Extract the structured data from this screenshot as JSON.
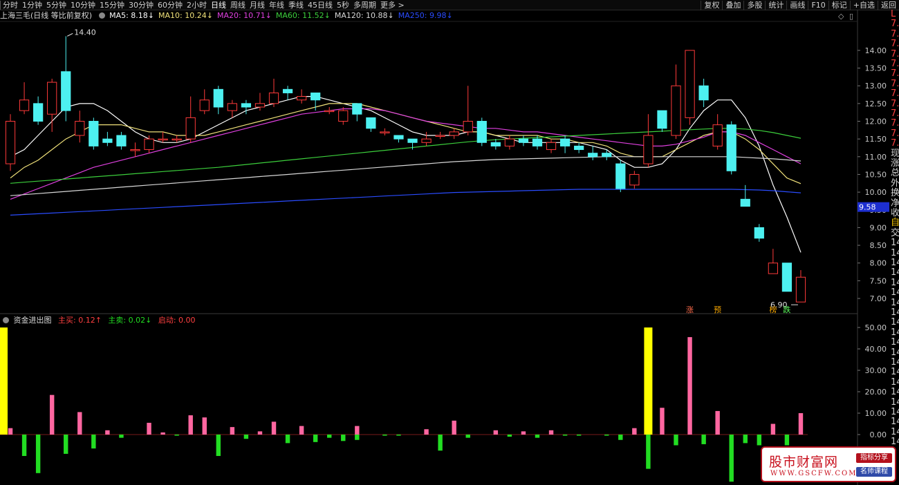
{
  "toolbar": {
    "periods": [
      "分时",
      "1分钟",
      "5分钟",
      "10分钟",
      "15分钟",
      "30分钟",
      "60分钟",
      "2小时",
      "日线",
      "周线",
      "月线",
      "年线",
      "季线",
      "45日线",
      "5秒",
      "多周期",
      "更多 >"
    ],
    "active_period": "日线",
    "right_tools": [
      "复权",
      "叠加",
      "多股",
      "统计",
      "画线",
      "F10",
      "标记",
      "+自选",
      "返回"
    ]
  },
  "legend": {
    "stock": "上海三毛(日线 等比前复权)",
    "ma": [
      {
        "label": "MA5: 8.18↓",
        "color": "#ffffff"
      },
      {
        "label": "MA10: 10.24↓",
        "color": "#f1e27a"
      },
      {
        "label": "MA20: 10.71↓",
        "color": "#e040e0"
      },
      {
        "label": "MA60: 11.52↓",
        "color": "#3cd03c"
      },
      {
        "label": "MA120: 10.88↓",
        "color": "#d8d8d8"
      },
      {
        "label": "MA250: 9.98↓",
        "color": "#2a4cff"
      }
    ]
  },
  "indicator": {
    "title": "资金进出图",
    "buy": "主买: 0.12↑",
    "sell": "主卖: 0.02↓",
    "start": "启动: 0.00"
  },
  "sidebar_chars": [
    {
      "t": "L",
      "c": "#ff4040"
    },
    {
      "t": "7.",
      "c": "#ff4040"
    },
    {
      "t": "7.",
      "c": "#ff4040"
    },
    {
      "t": "7.",
      "c": "#ff4040"
    },
    {
      "t": "7.",
      "c": "#ff4040"
    },
    {
      "t": "7.",
      "c": "#ff4040"
    },
    {
      "t": "7.",
      "c": "#ff4040"
    },
    {
      "t": "7.",
      "c": "#ff4040"
    },
    {
      "t": "7.",
      "c": "#ff4040"
    },
    {
      "t": "7.",
      "c": "#ff4040"
    },
    {
      "t": "7.",
      "c": "#ff4040"
    },
    {
      "t": "7.",
      "c": "#ff4040"
    },
    {
      "t": "7.",
      "c": "#ff4040"
    },
    {
      "t": "7.",
      "c": "#ff4040"
    },
    {
      "t": "现",
      "c": "#d0d0d0"
    },
    {
      "t": "涨",
      "c": "#d0d0d0"
    },
    {
      "t": "总",
      "c": "#d0d0d0"
    },
    {
      "t": "外",
      "c": "#d0d0d0"
    },
    {
      "t": "换",
      "c": "#d0d0d0"
    },
    {
      "t": "净",
      "c": "#d0d0d0"
    },
    {
      "t": "收",
      "c": "#d0d0d0"
    },
    {
      "t": "自",
      "c": "#f0c000"
    },
    {
      "t": "交",
      "c": "#d0d0d0"
    },
    {
      "t": "14",
      "c": "#d0d0d0"
    },
    {
      "t": "14",
      "c": "#d0d0d0"
    },
    {
      "t": "14",
      "c": "#d0d0d0"
    },
    {
      "t": "14",
      "c": "#d0d0d0"
    },
    {
      "t": "14",
      "c": "#d0d0d0"
    },
    {
      "t": "14",
      "c": "#d0d0d0"
    },
    {
      "t": "14",
      "c": "#d0d0d0"
    },
    {
      "t": "14",
      "c": "#d0d0d0"
    },
    {
      "t": "14",
      "c": "#d0d0d0"
    },
    {
      "t": "14",
      "c": "#d0d0d0"
    },
    {
      "t": "14",
      "c": "#d0d0d0"
    },
    {
      "t": "14",
      "c": "#d0d0d0"
    },
    {
      "t": "14",
      "c": "#d0d0d0"
    },
    {
      "t": "14",
      "c": "#d0d0d0"
    },
    {
      "t": "14",
      "c": "#d0d0d0"
    },
    {
      "t": "14",
      "c": "#d0d0d0"
    },
    {
      "t": "14",
      "c": "#d0d0d0"
    },
    {
      "t": "14",
      "c": "#d0d0d0"
    },
    {
      "t": "14",
      "c": "#d0d0d0"
    },
    {
      "t": "14",
      "c": "#d0d0d0"
    },
    {
      "t": "14",
      "c": "#d0d0d0"
    }
  ],
  "watermark": {
    "logo": "股市财富网",
    "url": "WWW.GSCFW.COM",
    "tag1": "指标分享",
    "tag2": "名师课程"
  },
  "chart_data": [
    {
      "type": "candlestick",
      "title": "上海三毛(日线 等比前复权)",
      "ylim": [
        6.7,
        14.8
      ],
      "y_ticks": [
        14.0,
        13.5,
        13.0,
        12.5,
        12.0,
        11.5,
        11.0,
        10.5,
        10.0,
        9.5,
        9.0,
        8.5,
        8.0,
        7.5,
        7.0
      ],
      "colors": {
        "up": "#ff3a3a",
        "down": "#4df0f0"
      },
      "candles": [
        [
          10.8,
          12.0,
          12.2,
          10.6
        ],
        [
          12.3,
          12.6,
          13.1,
          12.2
        ],
        [
          12.5,
          12.0,
          12.7,
          11.9
        ],
        [
          12.2,
          13.1,
          13.2,
          11.7
        ],
        [
          13.4,
          12.3,
          14.4,
          12.0
        ],
        [
          11.6,
          12.0,
          12.3,
          11.4
        ],
        [
          12.0,
          11.3,
          12.1,
          11.2
        ],
        [
          11.5,
          11.4,
          11.7,
          11.3
        ],
        [
          11.6,
          11.3,
          11.7,
          11.2
        ],
        [
          11.2,
          11.2,
          11.4,
          11.0
        ],
        [
          11.2,
          11.5,
          11.6,
          11.1
        ],
        [
          11.5,
          11.5,
          11.7,
          11.4
        ],
        [
          11.5,
          11.5,
          11.6,
          11.4
        ],
        [
          11.5,
          12.1,
          12.7,
          11.4
        ],
        [
          12.3,
          12.6,
          12.9,
          12.2
        ],
        [
          12.9,
          12.4,
          13.0,
          12.2
        ],
        [
          12.3,
          12.5,
          12.6,
          12.1
        ],
        [
          12.5,
          12.4,
          12.6,
          12.2
        ],
        [
          12.4,
          12.5,
          12.8,
          12.3
        ],
        [
          12.5,
          12.8,
          13.2,
          12.4
        ],
        [
          12.9,
          12.8,
          13.0,
          12.6
        ],
        [
          12.6,
          12.7,
          12.9,
          12.5
        ],
        [
          12.8,
          12.6,
          12.8,
          12.3
        ],
        [
          12.3,
          12.3,
          12.4,
          12.2
        ],
        [
          12.0,
          12.3,
          12.4,
          11.9
        ],
        [
          12.5,
          12.2,
          12.5,
          12.0
        ],
        [
          12.1,
          11.8,
          12.1,
          11.7
        ],
        [
          11.7,
          11.7,
          11.8,
          11.6
        ],
        [
          11.6,
          11.5,
          11.6,
          11.4
        ],
        [
          11.5,
          11.4,
          11.5,
          11.2
        ],
        [
          11.4,
          11.5,
          11.7,
          11.3
        ],
        [
          11.6,
          11.6,
          11.7,
          11.5
        ],
        [
          11.6,
          11.7,
          11.8,
          11.5
        ],
        [
          11.7,
          12.0,
          13.0,
          11.6
        ],
        [
          12.0,
          11.4,
          12.1,
          11.3
        ],
        [
          11.4,
          11.3,
          11.5,
          11.2
        ],
        [
          11.3,
          11.5,
          11.6,
          11.2
        ],
        [
          11.5,
          11.4,
          11.6,
          11.3
        ],
        [
          11.5,
          11.3,
          11.6,
          11.2
        ],
        [
          11.2,
          11.4,
          11.5,
          11.1
        ],
        [
          11.5,
          11.3,
          11.6,
          11.1
        ],
        [
          11.3,
          11.2,
          11.4,
          11.1
        ],
        [
          11.1,
          11.0,
          11.3,
          10.9
        ],
        [
          11.1,
          11.0,
          11.2,
          10.9
        ],
        [
          10.8,
          10.1,
          10.9,
          10.0
        ],
        [
          10.2,
          10.5,
          10.6,
          10.1
        ],
        [
          10.8,
          11.6,
          12.2,
          10.7
        ],
        [
          12.3,
          11.8,
          12.3,
          11.7
        ],
        [
          11.6,
          13.0,
          13.6,
          11.5
        ],
        [
          12.1,
          14.0,
          14.0,
          11.9
        ],
        [
          13.0,
          12.6,
          13.2,
          12.4
        ],
        [
          11.3,
          11.9,
          12.2,
          11.2
        ],
        [
          11.9,
          10.6,
          12.0,
          10.5
        ],
        [
          9.8,
          9.6,
          10.2,
          9.6
        ],
        [
          9.0,
          8.7,
          9.1,
          8.6
        ],
        [
          7.7,
          8.0,
          8.4,
          7.7
        ],
        [
          8.0,
          7.2,
          8.0,
          7.2
        ],
        [
          6.9,
          7.6,
          7.8,
          6.9
        ]
      ],
      "ma_series": [
        {
          "name": "MA5",
          "color": "#ffffff",
          "values": [
            11.0,
            11.2,
            11.6,
            12.0,
            12.4,
            12.5,
            12.5,
            12.3,
            12.0,
            11.7,
            11.5,
            11.4,
            11.4,
            11.5,
            11.7,
            11.9,
            12.1,
            12.3,
            12.4,
            12.5,
            12.6,
            12.7,
            12.7,
            12.6,
            12.5,
            12.4,
            12.3,
            12.1,
            11.9,
            11.7,
            11.6,
            11.6,
            11.6,
            11.7,
            11.7,
            11.6,
            11.5,
            11.4,
            11.4,
            11.4,
            11.4,
            11.4,
            11.3,
            11.2,
            10.9,
            10.7,
            10.7,
            10.8,
            11.2,
            11.8,
            12.3,
            12.6,
            12.6,
            12.1,
            11.3,
            10.2,
            9.3,
            8.3
          ]
        },
        {
          "name": "MA10",
          "color": "#f1e27a",
          "values": [
            10.4,
            10.7,
            10.9,
            11.2,
            11.5,
            11.7,
            11.9,
            11.9,
            11.9,
            11.8,
            11.7,
            11.7,
            11.6,
            11.6,
            11.6,
            11.7,
            11.8,
            11.9,
            12.0,
            12.1,
            12.2,
            12.3,
            12.4,
            12.5,
            12.5,
            12.5,
            12.4,
            12.3,
            12.2,
            12.1,
            12.0,
            11.9,
            11.8,
            11.7,
            11.7,
            11.6,
            11.6,
            11.6,
            11.6,
            11.5,
            11.5,
            11.4,
            11.4,
            11.3,
            11.1,
            11.0,
            11.0,
            11.0,
            11.2,
            11.4,
            11.6,
            11.7,
            11.7,
            11.5,
            11.2,
            10.8,
            10.4,
            10.24
          ]
        },
        {
          "name": "MA20",
          "color": "#e040e0",
          "values": [
            9.8,
            9.95,
            10.1,
            10.25,
            10.4,
            10.55,
            10.7,
            10.8,
            10.9,
            11.0,
            11.1,
            11.2,
            11.3,
            11.4,
            11.5,
            11.6,
            11.7,
            11.8,
            11.9,
            12.0,
            12.1,
            12.2,
            12.25,
            12.3,
            12.35,
            12.35,
            12.35,
            12.3,
            12.2,
            12.1,
            12.0,
            11.95,
            11.9,
            11.85,
            11.8,
            11.8,
            11.75,
            11.7,
            11.7,
            11.65,
            11.6,
            11.55,
            11.5,
            11.45,
            11.4,
            11.35,
            11.3,
            11.3,
            11.35,
            11.45,
            11.55,
            11.7,
            11.7,
            11.6,
            11.4,
            11.2,
            11.0,
            10.8
          ]
        },
        {
          "name": "MA60",
          "color": "#3cd03c",
          "values": [
            10.25,
            10.28,
            10.31,
            10.34,
            10.37,
            10.4,
            10.43,
            10.46,
            10.49,
            10.52,
            10.55,
            10.58,
            10.61,
            10.64,
            10.67,
            10.7,
            10.74,
            10.78,
            10.82,
            10.86,
            10.9,
            10.94,
            10.98,
            11.02,
            11.06,
            11.1,
            11.14,
            11.18,
            11.22,
            11.26,
            11.3,
            11.34,
            11.38,
            11.42,
            11.45,
            11.48,
            11.5,
            11.52,
            11.54,
            11.56,
            11.58,
            11.6,
            11.62,
            11.64,
            11.66,
            11.68,
            11.7,
            11.72,
            11.74,
            11.76,
            11.78,
            11.8,
            11.8,
            11.78,
            11.74,
            11.68,
            11.6,
            11.52
          ]
        },
        {
          "name": "MA120",
          "color": "#d8d8d8",
          "values": [
            9.9,
            9.93,
            9.96,
            9.99,
            10.02,
            10.05,
            10.08,
            10.11,
            10.14,
            10.17,
            10.2,
            10.23,
            10.26,
            10.29,
            10.32,
            10.35,
            10.38,
            10.41,
            10.44,
            10.47,
            10.5,
            10.53,
            10.56,
            10.59,
            10.62,
            10.65,
            10.68,
            10.71,
            10.74,
            10.77,
            10.8,
            10.83,
            10.86,
            10.88,
            10.9,
            10.92,
            10.93,
            10.94,
            10.95,
            10.96,
            10.97,
            10.98,
            10.99,
            11.0,
            11.0,
            11.0,
            11.0,
            11.0,
            11.0,
            11.0,
            11.0,
            11.0,
            11.0,
            10.98,
            10.96,
            10.94,
            10.91,
            10.88
          ]
        },
        {
          "name": "MA250",
          "color": "#2a4cff",
          "values": [
            9.35,
            9.37,
            9.39,
            9.41,
            9.43,
            9.45,
            9.47,
            9.49,
            9.51,
            9.53,
            9.55,
            9.57,
            9.59,
            9.61,
            9.63,
            9.65,
            9.67,
            9.69,
            9.71,
            9.73,
            9.75,
            9.77,
            9.79,
            9.81,
            9.83,
            9.85,
            9.87,
            9.89,
            9.91,
            9.93,
            9.95,
            9.97,
            9.99,
            10.0,
            10.01,
            10.02,
            10.03,
            10.04,
            10.05,
            10.06,
            10.07,
            10.08,
            10.08,
            10.08,
            10.08,
            10.08,
            10.08,
            10.08,
            10.08,
            10.08,
            10.08,
            10.08,
            10.08,
            10.07,
            10.06,
            10.04,
            10.01,
            9.98
          ]
        }
      ],
      "annotations": {
        "max_label": "14.40",
        "min_label": "6.90",
        "price_marker": "9.58",
        "signals": [
          {
            "index": 49,
            "text": "涨",
            "color": "#ff6b4a"
          },
          {
            "index": 51,
            "text": "预",
            "color": "#f6a600"
          },
          {
            "index": 55,
            "text": "榜",
            "color": "#f6a600"
          },
          {
            "index": 56,
            "text": "跌",
            "color": "#5dff5d"
          }
        ]
      }
    },
    {
      "type": "bar",
      "title": "资金进出图",
      "ylim": [
        -22,
        52
      ],
      "y_ticks": [
        50.0,
        40.0,
        30.0,
        20.0,
        10.0,
        0.0
      ],
      "colors": {
        "buy": "#ff66a0",
        "sell": "#22dd22",
        "start": "#ffff00"
      },
      "buy": [
        3,
        0,
        0,
        18.5,
        0,
        10.5,
        0,
        2,
        0,
        0,
        5.5,
        1,
        0,
        9,
        8,
        0,
        3.5,
        0,
        1.5,
        6,
        0,
        4,
        0,
        0,
        0,
        4,
        0,
        0,
        0,
        0,
        2.5,
        0,
        6.5,
        0,
        0,
        2,
        0,
        1.5,
        0,
        2,
        0,
        0,
        0,
        0,
        0,
        3,
        0,
        12.5,
        0,
        45.5,
        0,
        11,
        0,
        0,
        0,
        5,
        0,
        10
      ],
      "sell": [
        0,
        -10,
        -18,
        0,
        -9,
        0,
        -6.5,
        0,
        -1.5,
        0,
        0,
        0,
        -0.5,
        0,
        0,
        -10,
        0,
        -2,
        0,
        0,
        -4,
        0,
        -3.5,
        -1.5,
        -3,
        -2.5,
        0,
        -0.5,
        -0.5,
        0,
        0,
        -7.5,
        0,
        -1.5,
        0,
        0,
        -1,
        0,
        -1.5,
        0,
        -0.5,
        -0.5,
        0,
        -0.5,
        -2.5,
        0,
        -16,
        0,
        -5,
        0,
        -4.5,
        0,
        -22,
        -4,
        -5,
        0,
        -5,
        0
      ],
      "start_index": [
        0,
        46
      ],
      "start_values": [
        50,
        50
      ]
    }
  ]
}
